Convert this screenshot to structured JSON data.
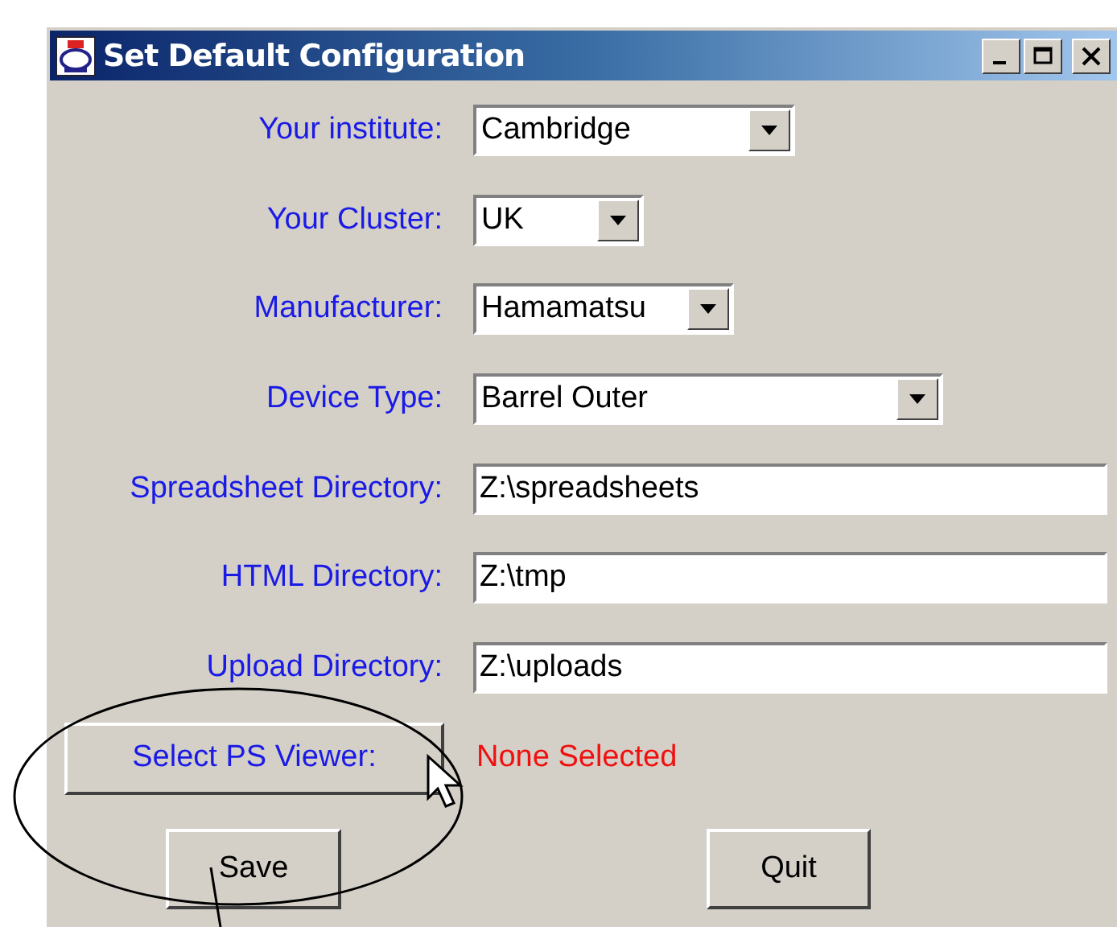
{
  "window": {
    "title": "Set Default Configuration"
  },
  "fields": [
    {
      "label": "Your institute:",
      "kind": "combo",
      "value": "Cambridge"
    },
    {
      "label": "Your Cluster:",
      "kind": "combo",
      "value": "UK"
    },
    {
      "label": "Manufacturer:",
      "kind": "combo",
      "value": "Hamamatsu"
    },
    {
      "label": "Device Type:",
      "kind": "combo",
      "value": "Barrel Outer"
    },
    {
      "label": "Spreadsheet Directory:",
      "kind": "text",
      "value": "Z:\\spreadsheets"
    },
    {
      "label": "HTML Directory:",
      "kind": "text",
      "value": "Z:\\tmp"
    },
    {
      "label": "Upload Directory:",
      "kind": "text",
      "value": "Z:\\uploads"
    }
  ],
  "viewer": {
    "button": "Select PS Viewer:",
    "status": "None Selected"
  },
  "buttons": [
    "Save",
    "Quit"
  ]
}
